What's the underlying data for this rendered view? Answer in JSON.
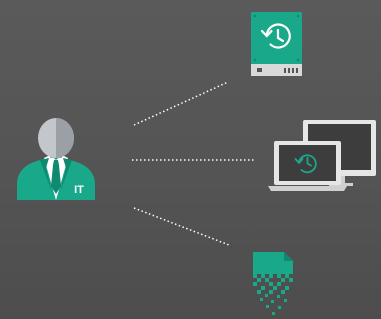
{
  "colors": {
    "background": "#555555",
    "accent": "#1aa88a",
    "accent_dark": "#0f8a70",
    "head": "#c3c7cc",
    "head_shade": "#9aa0a6",
    "device_light": "#e6e6e6",
    "device_dark": "#3d3d3d"
  },
  "it_person": {
    "badge_label": "IT",
    "icon": "it-person-icon"
  },
  "targets": [
    {
      "icon": "hard-drive-backup-icon"
    },
    {
      "icon": "computer-backup-icon"
    },
    {
      "icon": "corrupted-file-icon"
    }
  ]
}
